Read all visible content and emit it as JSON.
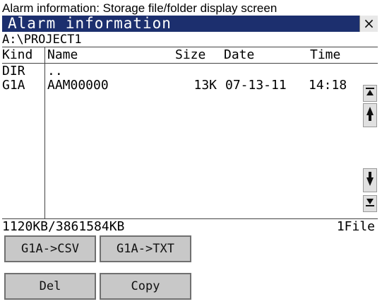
{
  "caption": "Alarm information: Storage file/folder display screen",
  "window": {
    "title": "Alarm information",
    "close_label": "×"
  },
  "path": "A:\\PROJECT1",
  "columns": {
    "kind": "Kind",
    "name": "Name",
    "size": "Size",
    "date": "Date",
    "time": "Time"
  },
  "rows": [
    {
      "kind": "DIR",
      "name": "..",
      "size": "",
      "date": "",
      "time": ""
    },
    {
      "kind": "G1A",
      "name": "AAM00000",
      "size": "13K",
      "date": "07-13-11",
      "time": "14:18"
    }
  ],
  "scrollbar": {
    "top_icon": "scroll-to-top-icon",
    "up_icon": "scroll-up-icon",
    "down_icon": "scroll-down-icon",
    "bottom_icon": "scroll-to-bottom-icon"
  },
  "status": {
    "capacity": "1120KB/3861584KB",
    "file_count": "1File"
  },
  "buttons": {
    "csv": "G1A->CSV",
    "txt": "G1A->TXT",
    "delete": "Del",
    "copy": "Copy"
  },
  "colors": {
    "titlebar": "#1c2f6e",
    "button_face": "#c8c8c8"
  }
}
